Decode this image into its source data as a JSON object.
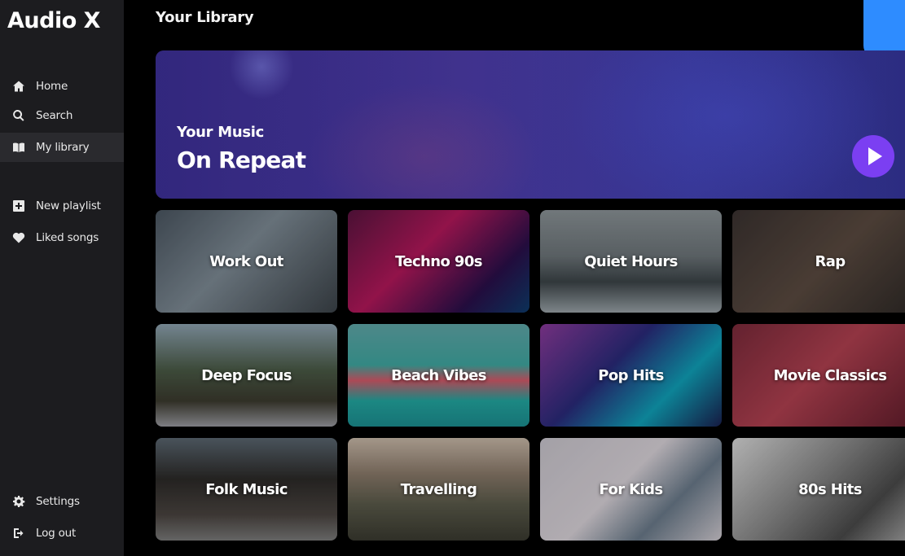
{
  "app": {
    "title": "Audio X"
  },
  "sidebar": {
    "items": [
      {
        "label": "Home",
        "icon": "home-icon"
      },
      {
        "label": "Search",
        "icon": "search-icon"
      },
      {
        "label": "My library",
        "icon": "book-icon",
        "active": true
      },
      {
        "label": "New playlist",
        "icon": "plus-square-icon"
      },
      {
        "label": "Liked songs",
        "icon": "heart-icon"
      },
      {
        "label": "Settings",
        "icon": "gear-icon"
      },
      {
        "label": "Log out",
        "icon": "logout-icon"
      }
    ]
  },
  "main": {
    "title": "Your Library",
    "hero": {
      "subtitle": "Your Music",
      "title": "On Repeat",
      "play_icon": "play-icon"
    },
    "tiles": [
      {
        "label": "Work Out"
      },
      {
        "label": "Techno 90s"
      },
      {
        "label": "Quiet Hours"
      },
      {
        "label": "Rap"
      },
      {
        "label": "Deep Focus"
      },
      {
        "label": "Beach Vibes"
      },
      {
        "label": "Pop Hits"
      },
      {
        "label": "Movie Classics"
      },
      {
        "label": "Folk Music"
      },
      {
        "label": "Travelling"
      },
      {
        "label": "For Kids"
      },
      {
        "label": "80s Hits"
      }
    ]
  },
  "colors": {
    "sidebar_bg": "#1c1c1f",
    "accent_play": "#7b3ff2",
    "corner_badge": "#2e8cff"
  }
}
